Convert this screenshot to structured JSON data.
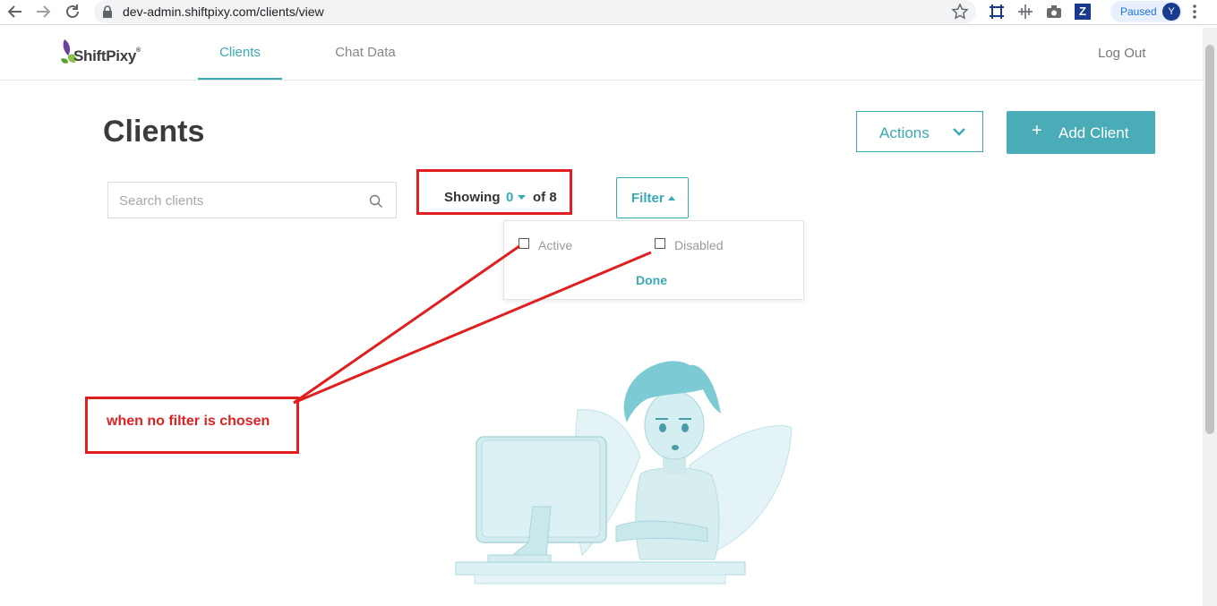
{
  "browser": {
    "url": "dev-admin.shiftpixy.com/clients/view",
    "profile_status": "Paused",
    "profile_initial": "Y",
    "extension_letter": "Z"
  },
  "header": {
    "logo_text": "ShiftPixy",
    "logo_mark": "®",
    "tabs": [
      {
        "label": "Clients",
        "active": true
      },
      {
        "label": "Chat Data",
        "active": false
      }
    ],
    "logout_label": "Log Out"
  },
  "page": {
    "title": "Clients",
    "actions_label": "Actions",
    "add_client_label": "Add Client",
    "add_client_symbol": "+",
    "search_placeholder": "Search clients",
    "showing_label": "Showing",
    "showing_value": "0",
    "showing_total": "of 8",
    "filter_label": "Filter",
    "filter_options": [
      {
        "label": "Active",
        "checked": false
      },
      {
        "label": "Disabled",
        "checked": false
      }
    ],
    "done_label": "Done"
  },
  "annotation": {
    "text": "when no filter is chosen",
    "color": "#e02020"
  },
  "colors": {
    "accent": "#3aa9b6",
    "button_fill": "#4aacb6",
    "title": "#3b3b3b"
  }
}
